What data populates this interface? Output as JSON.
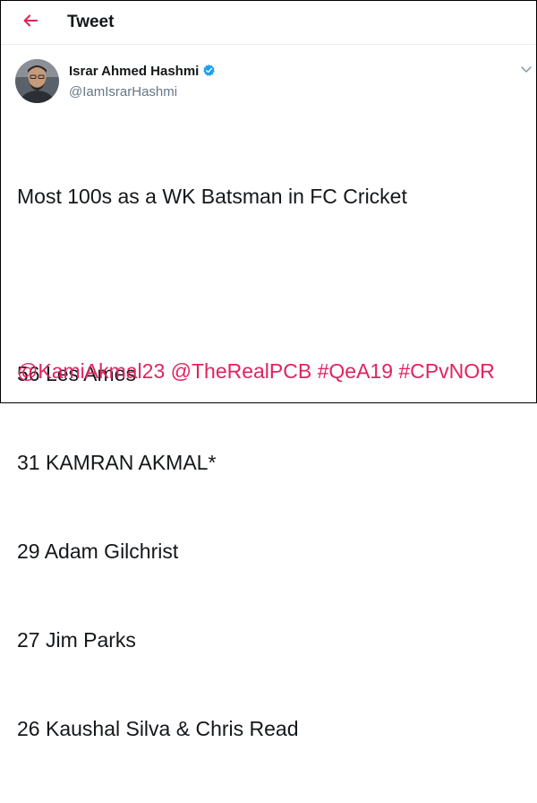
{
  "header": {
    "title": "Tweet",
    "back_icon": "arrow-left-icon",
    "accent": "#e0245e"
  },
  "tweet": {
    "author_name": "Israr Ahmed Hashmi",
    "author_handle": "@IamIsrarHashmi",
    "verified_icon": "verified-badge-icon",
    "menu_icon": "chevron-down-icon",
    "lines": [
      "Most 100s as a WK Batsman in FC Cricket",
      "",
      "56 Les Ames",
      "31 KAMRAN AKMAL*",
      "29 Adam Gilchrist",
      "27 Jim Parks",
      "26 Kaushal Silva & Chris Read"
    ],
    "tags": [
      "@KamiAkmal23",
      "@TheRealPCB",
      "#QeA19",
      "#CPvNOR"
    ],
    "text_color": "#14171a",
    "link_color": "#e0245e",
    "verified_color": "#1da1f2"
  }
}
